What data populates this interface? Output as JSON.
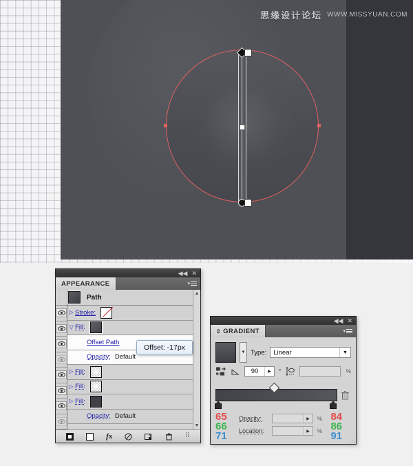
{
  "canvas": {
    "watermark_cn": "思缘设计论坛",
    "watermark_url": "WWW.MISSYUAN.COM"
  },
  "appearance": {
    "window_controls": {
      "collapse": "◀◀",
      "close": "✕"
    },
    "tab_label": "APPEARANCE",
    "object_label": "Path",
    "rows": [
      {
        "name": "stroke",
        "label": "Stroke:",
        "swatch": "none",
        "visible": true,
        "expander": "▷",
        "white": false
      },
      {
        "name": "fill",
        "label": "Fill:",
        "swatch": "solid",
        "visible": true,
        "expander": "▽",
        "white": false
      },
      {
        "name": "offset-path",
        "label": "Offset Path",
        "swatch": "",
        "visible": true,
        "expander": "",
        "white": true
      },
      {
        "name": "opacity-effect",
        "label": "Opacity:",
        "value": "Default",
        "swatch": "",
        "visible": false,
        "expander": "",
        "white": true
      },
      {
        "name": "fill-2",
        "label": "Fill:",
        "swatch": "radial",
        "visible": true,
        "expander": "▷",
        "white": false
      },
      {
        "name": "fill-3",
        "label": "Fill:",
        "swatch": "radial",
        "visible": true,
        "expander": "▷",
        "white": false
      },
      {
        "name": "fill-4",
        "label": "Fill:",
        "swatch": "dark",
        "visible": true,
        "expander": "▷",
        "white": false
      },
      {
        "name": "opacity-object",
        "label": "Opacity:",
        "value": "Default",
        "swatch": "",
        "visible": false,
        "expander": "",
        "white": false
      }
    ],
    "tooltip": "Offset: -17px",
    "toolbar": [
      {
        "name": "add-new-stroke",
        "glyph": "stroke"
      },
      {
        "name": "add-new-fill",
        "glyph": "fill"
      },
      {
        "name": "add-new-effect",
        "glyph": "fx"
      },
      {
        "name": "clear-appearance",
        "glyph": "clear"
      },
      {
        "name": "duplicate-item",
        "glyph": "duplicate"
      },
      {
        "name": "delete-item",
        "glyph": "trash"
      }
    ],
    "scroll_up": "▲",
    "scroll_down": "▼"
  },
  "gradient": {
    "window_controls": {
      "collapse": "◀◀",
      "close": "✕"
    },
    "tab_label": "GRADIENT",
    "type_label": "Type:",
    "type_value": "Linear",
    "angle_value": "90",
    "angle_unit": "°",
    "aspect_value": "",
    "aspect_unit": "%",
    "stepper_glyph": "▶",
    "dropdown_glyph": "▼",
    "opacity_label": "Opacity:",
    "opacity_value": "",
    "opacity_unit": "%",
    "location_label": "Location:",
    "location_value": "",
    "location_unit": "%",
    "stop_left_rgb": {
      "r": "65",
      "g": "66",
      "b": "71"
    },
    "stop_right_rgb": {
      "r": "84",
      "g": "86",
      "b": "91"
    }
  }
}
